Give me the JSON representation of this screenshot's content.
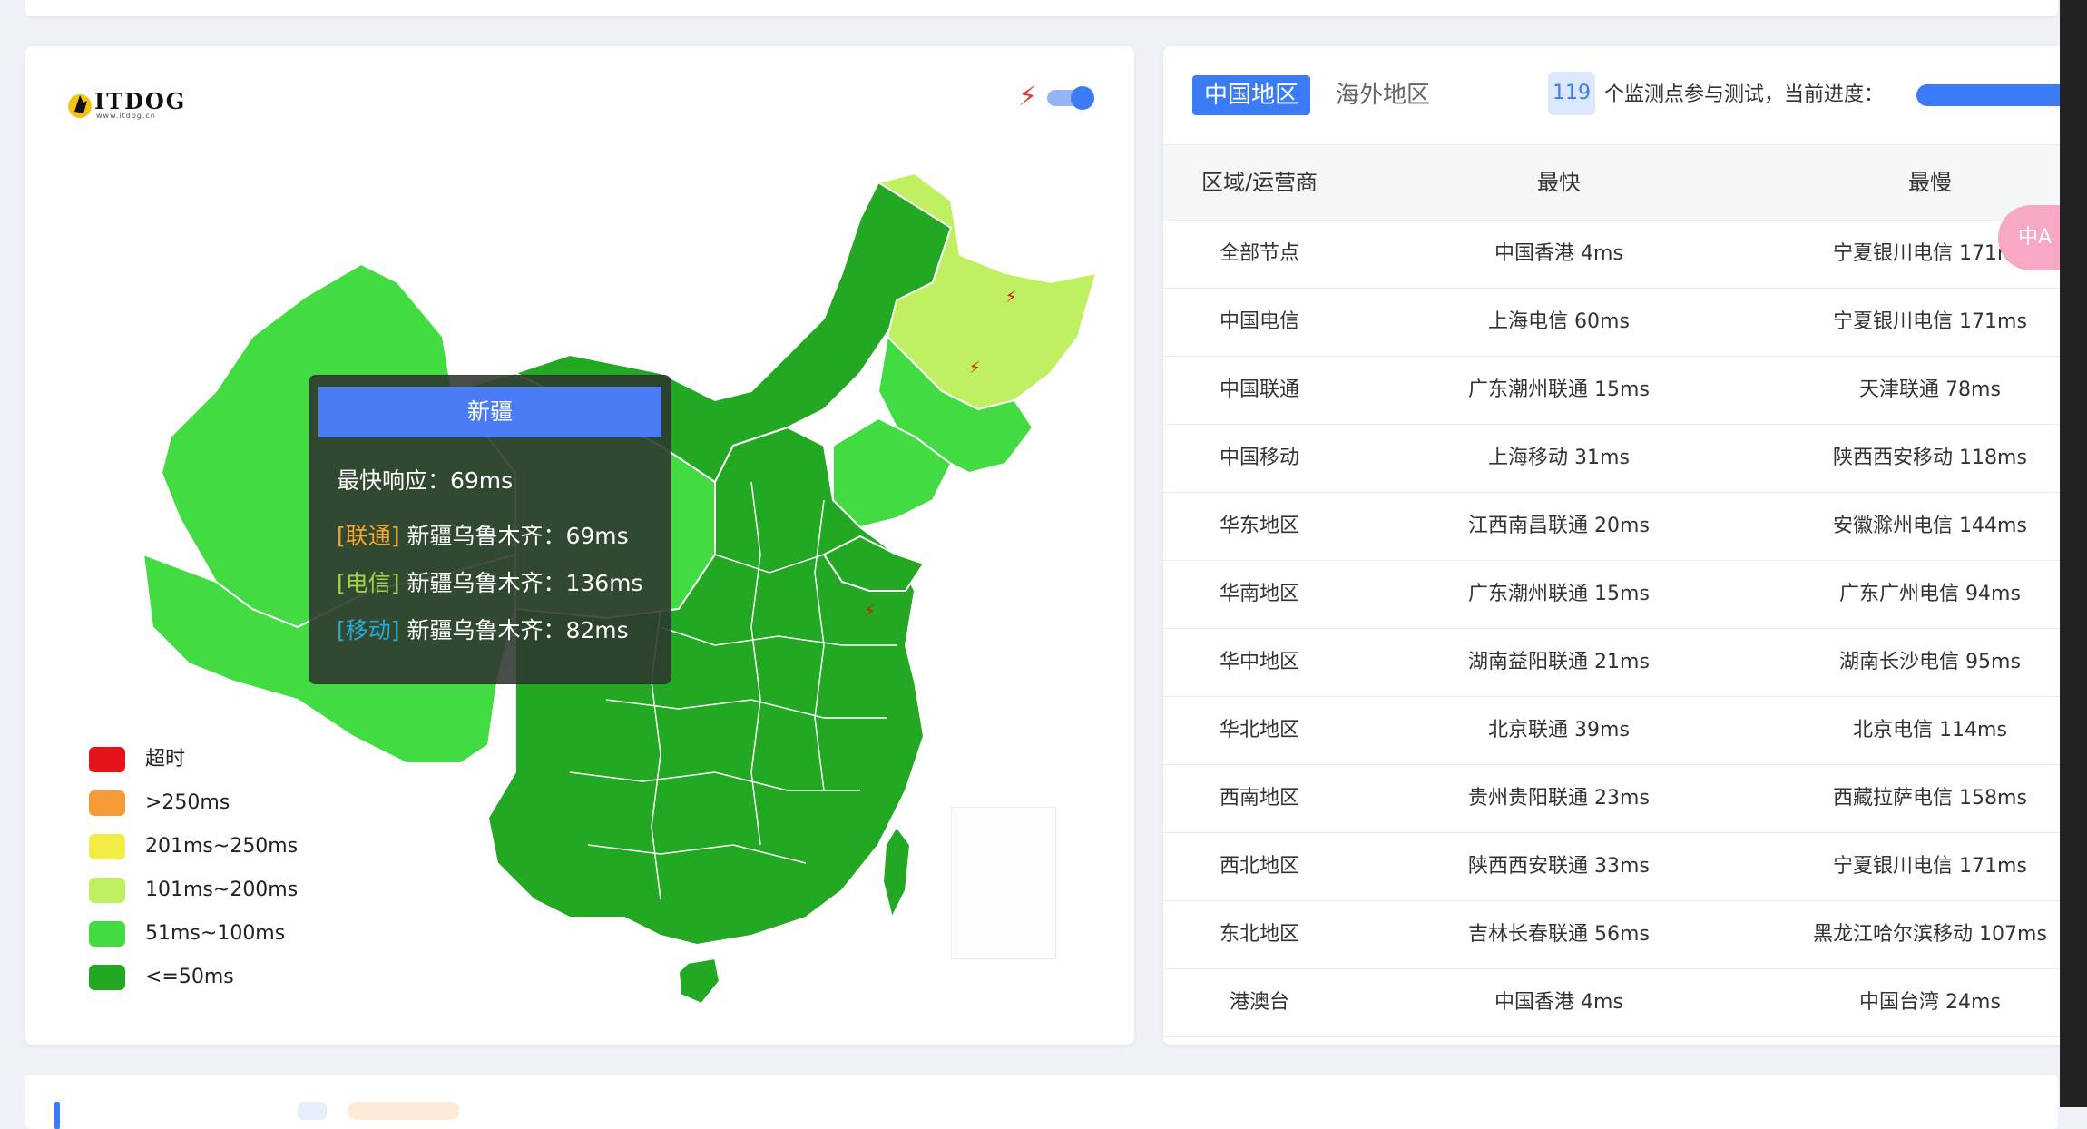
{
  "logo": {
    "text": "ITDOG",
    "subtext": "www.itdog.cn"
  },
  "map": {
    "tooltip": {
      "title": "新疆",
      "fastest": "最快响应：69ms",
      "rows": [
        {
          "tag": "[联通]",
          "text": " 新疆乌鲁木齐：69ms"
        },
        {
          "tag": "[电信]",
          "text": " 新疆乌鲁木齐：136ms"
        },
        {
          "tag": "[移动]",
          "text": " 新疆乌鲁木齐：82ms"
        }
      ]
    },
    "legend": [
      {
        "label": "超时",
        "color": "#e5141b"
      },
      {
        "label": ">250ms",
        "color": "#f79a38"
      },
      {
        "label": "201ms~250ms",
        "color": "#f3ec47"
      },
      {
        "label": "101ms~200ms",
        "color": "#bef062"
      },
      {
        "label": "51ms~100ms",
        "color": "#42dc42"
      },
      {
        "label": "<=50ms",
        "color": "#22a822"
      }
    ]
  },
  "panel": {
    "tab_china": "中国地区",
    "tab_overseas": "海外地区",
    "node_count": "119",
    "count_text": "个监测点参与测试，当前进度：",
    "progress_label": "1",
    "headers": [
      "区域/运营商",
      "最快",
      "最慢"
    ],
    "rows": [
      [
        "全部节点",
        "中国香港 4ms",
        "宁夏银川电信 171ms"
      ],
      [
        "中国电信",
        "上海电信 60ms",
        "宁夏银川电信 171ms"
      ],
      [
        "中国联通",
        "广东潮州联通 15ms",
        "天津联通 78ms"
      ],
      [
        "中国移动",
        "上海移动 31ms",
        "陕西西安移动 118ms"
      ],
      [
        "华东地区",
        "江西南昌联通 20ms",
        "安徽滁州电信 144ms"
      ],
      [
        "华南地区",
        "广东潮州联通 15ms",
        "广东广州电信 94ms"
      ],
      [
        "华中地区",
        "湖南益阳联通 21ms",
        "湖南长沙电信 95ms"
      ],
      [
        "华北地区",
        "北京联通 39ms",
        "北京电信 114ms"
      ],
      [
        "西南地区",
        "贵州贵阳联通 23ms",
        "西藏拉萨电信 158ms"
      ],
      [
        "西北地区",
        "陕西西安联通 33ms",
        "宁夏银川电信 171ms"
      ],
      [
        "东北地区",
        "吉林长春联通 56ms",
        "黑龙江哈尔滨移动 107ms"
      ],
      [
        "港澳台",
        "中国香港 4ms",
        "中国台湾 24ms"
      ]
    ],
    "translate_label": "中A"
  }
}
